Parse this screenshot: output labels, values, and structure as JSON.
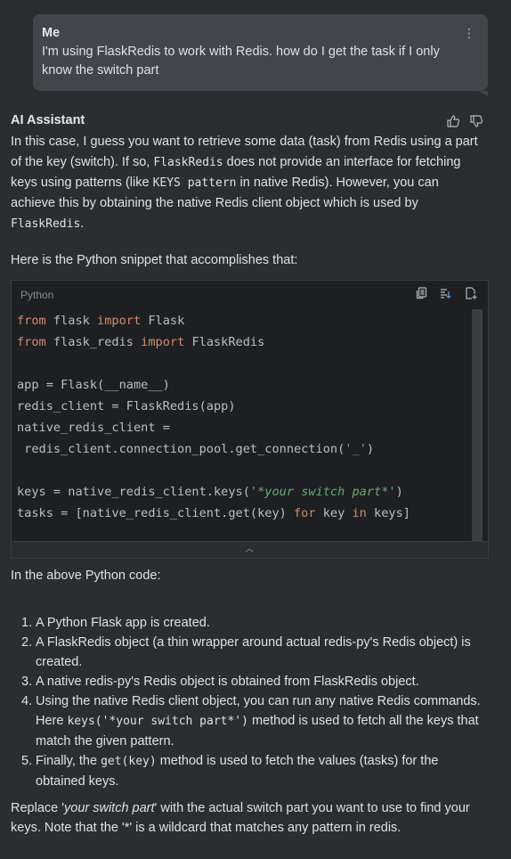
{
  "user_message": {
    "author": "Me",
    "text": "I'm using FlaskRedis to work with Redis. how do I get the task if I only know the switch part",
    "menu_icon": "kebab-icon"
  },
  "assistant": {
    "author": "AI Assistant",
    "intro": {
      "t1": "In this case, I guess you want to retrieve some data (task) from Redis using a part of the key (switch). If so, ",
      "c1": "FlaskRedis",
      "t2": " does not provide an interface for fetching keys using patterns (like ",
      "c2": "KEYS pattern",
      "t3": " in native Redis). However, you can achieve this by obtaining the native Redis client object which is used by ",
      "c3": "FlaskRedis",
      "t4": "."
    },
    "snippet_intro": "Here is the Python snippet that accomplishes that:",
    "code": {
      "language": "Python",
      "l1_kw1": "from",
      "l1_a": " flask ",
      "l1_kw2": "import",
      "l1_b": " Flask",
      "l2_kw1": "from",
      "l2_a": " flask_redis ",
      "l2_kw2": "import",
      "l2_b": " FlaskRedis",
      "l4": "app = Flask(__name__)",
      "l5": "redis_client = FlaskRedis(app)",
      "l6": "native_redis_client =",
      "l7_a": " redis_client.connection_pool.get_connection(",
      "l7_str": "'_'",
      "l7_b": ")",
      "l9_a": "keys = native_redis_client.keys(",
      "l9_str1": "'",
      "l9_str2": "*your switch part*",
      "l9_str3": "'",
      "l9_b": ")",
      "l10_a": "tasks = [native_redis_client.get(key) ",
      "l10_kw1": "for",
      "l10_b": " key ",
      "l10_kw2": "in",
      "l10_c": " keys]"
    },
    "after_code": "In the above Python code:",
    "list": [
      {
        "num": "1.",
        "text": "A Python Flask app is created."
      },
      {
        "num": "2.",
        "text": "A FlaskRedis object (a thin wrapper around actual redis-py's Redis object) is created."
      },
      {
        "num": "3.",
        "text": "A native redis-py's Redis object is obtained from FlaskRedis object."
      },
      {
        "num": "4.",
        "t1": "Using the native Redis client object, you can run any native Redis commands. Here ",
        "c1": "keys('*your switch part*')",
        "t2": " method is used to fetch all the keys that match the given pattern."
      },
      {
        "num": "5.",
        "t1": "Finally, the ",
        "c1": "get(key)",
        "t2": " method is used to fetch the values (tasks) for the obtained keys."
      }
    ],
    "closing": {
      "t1": "Replace '",
      "em": "your switch part",
      "t2": "' with the actual switch part you want to use to find your keys. Note that the '*' is a wildcard that matches any pattern in redis."
    }
  },
  "colors": {
    "background": "#2b2d30",
    "bubble": "#43454a",
    "code_bg": "#1e1f22",
    "keyword": "#cf8e6d",
    "string": "#6aab73"
  }
}
